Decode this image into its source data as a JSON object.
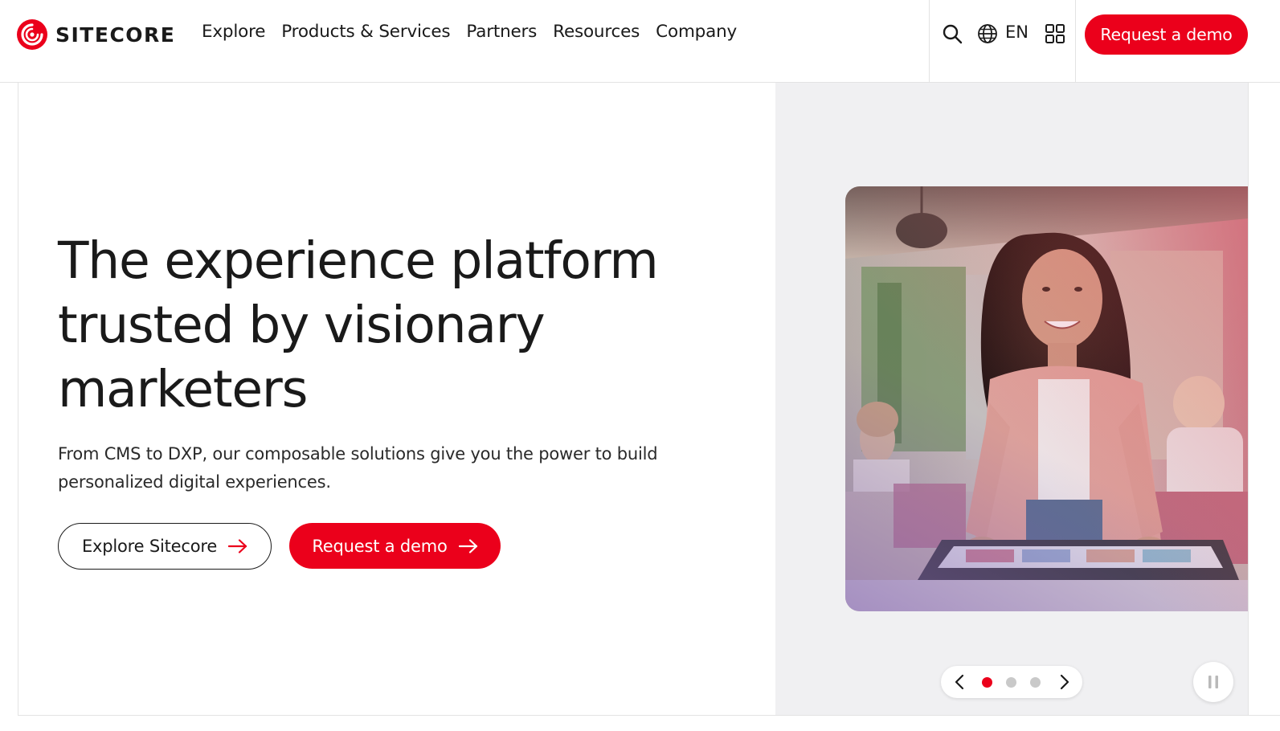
{
  "brand": {
    "name": "SITECORE",
    "accent": "#eb001b",
    "logo_icon": "sitecore-swirl-icon"
  },
  "nav": {
    "items": [
      {
        "label": "Explore"
      },
      {
        "label": "Products & Services"
      },
      {
        "label": "Partners"
      },
      {
        "label": "Resources"
      },
      {
        "label": "Company"
      }
    ]
  },
  "utility": {
    "search_icon": "search-icon",
    "language_icon": "globe-icon",
    "language": "EN",
    "apps_icon": "grid-icon",
    "cta_label": "Request a demo"
  },
  "hero": {
    "headline": "The experience platform trusted by visionary marketers",
    "subtext": "From CMS to DXP, our composable solutions give you the power to build personalized digital experiences.",
    "primary_button": "Explore Sitecore",
    "secondary_button": "Request a demo",
    "image_alt": "Smiling woman leaning over a table in an office"
  },
  "carousel": {
    "slide_count": 3,
    "active_slide": 1,
    "prev_icon": "chevron-left-icon",
    "next_icon": "chevron-right-icon",
    "pause_icon": "pause-icon"
  }
}
